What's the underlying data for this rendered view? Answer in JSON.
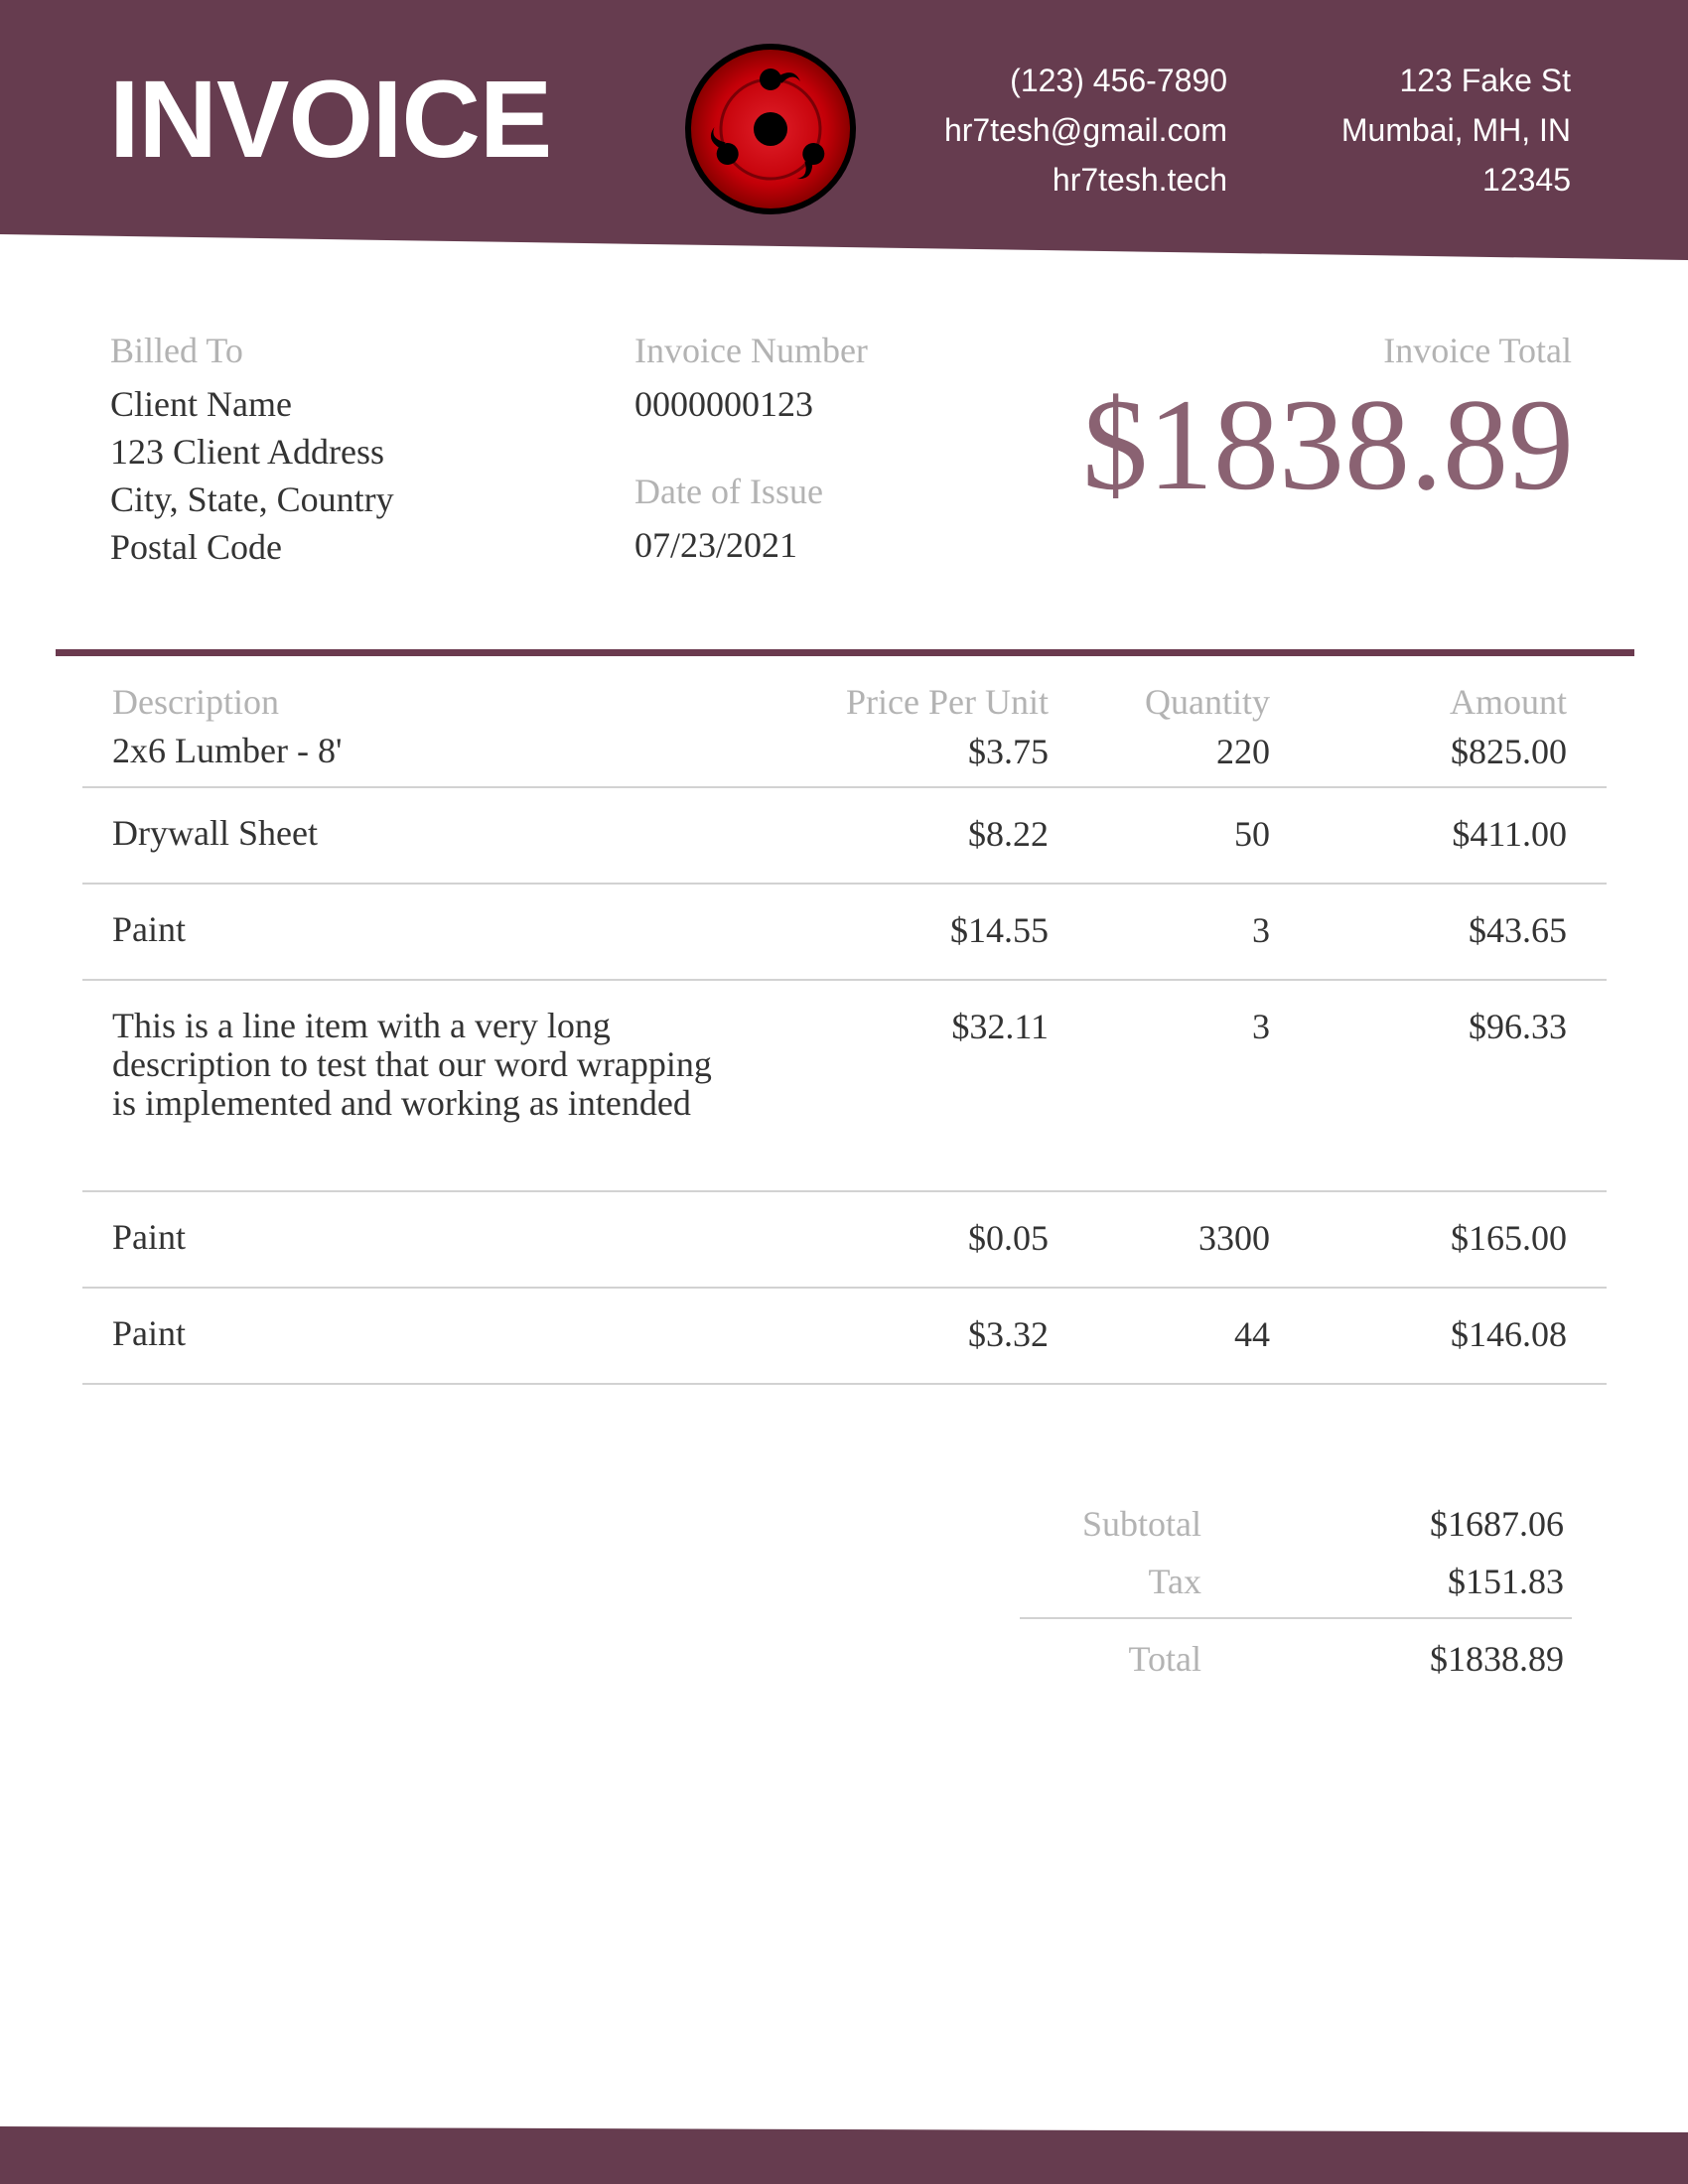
{
  "colors": {
    "brand": "#663c4f",
    "accent_text": "#8a6272",
    "label": "#b3b3b3",
    "text": "#333333",
    "logo_red": "#cc0000"
  },
  "header": {
    "title": "INVOICE",
    "logo_icon": "sharingan-logo-icon",
    "contact": {
      "phone": "(123) 456-7890",
      "email": "hr7tesh@gmail.com",
      "website": "hr7tesh.tech"
    },
    "address": {
      "street": "123 Fake St",
      "city": "Mumbai, MH, IN",
      "postal": "12345"
    }
  },
  "billing": {
    "billed_to_label": "Billed To",
    "client_name": "Client Name",
    "client_address": "123 Client Address",
    "client_city": "City, State, Country",
    "client_postal": "Postal Code",
    "invoice_number_label": "Invoice Number",
    "invoice_number": "0000000123",
    "date_label": "Date of Issue",
    "date": "07/23/2021",
    "invoice_total_label": "Invoice Total",
    "invoice_total": "$1838.89"
  },
  "table": {
    "headers": {
      "description": "Description",
      "price": "Price Per Unit",
      "quantity": "Quantity",
      "amount": "Amount"
    },
    "rows": [
      {
        "description": "2x6 Lumber - 8'",
        "price": "$3.75",
        "quantity": "220",
        "amount": "$825.00"
      },
      {
        "description": "Drywall Sheet",
        "price": "$8.22",
        "quantity": "50",
        "amount": "$411.00"
      },
      {
        "description": "Paint",
        "price": "$14.55",
        "quantity": "3",
        "amount": "$43.65"
      },
      {
        "description": "This is a line item with a very long description to test that our word wrapping is implemented and working as intended",
        "price": "$32.11",
        "quantity": "3",
        "amount": "$96.33"
      },
      {
        "description": "Paint",
        "price": "$0.05",
        "quantity": "3300",
        "amount": "$165.00"
      },
      {
        "description": "Paint",
        "price": "$3.32",
        "quantity": "44",
        "amount": "$146.08"
      }
    ]
  },
  "totals": {
    "subtotal_label": "Subtotal",
    "subtotal": "$1687.06",
    "tax_label": "Tax",
    "tax": "$151.83",
    "total_label": "Total",
    "total": "$1838.89"
  }
}
